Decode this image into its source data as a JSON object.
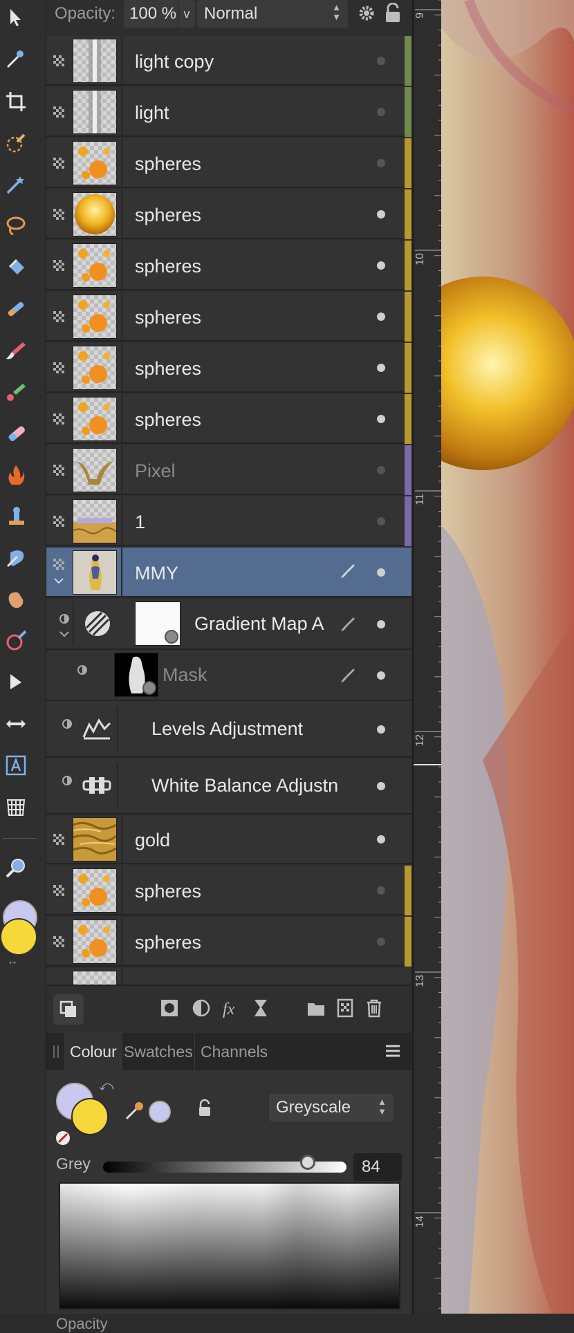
{
  "header": {
    "opacity_label": "Opacity:",
    "opacity_value": "100 %",
    "blend_mode": "Normal"
  },
  "layers": [
    {
      "name": "light copy",
      "visible": false,
      "tag": "#6f8a4b",
      "thumb": "light-streak"
    },
    {
      "name": "light",
      "visible": false,
      "tag": "#6f8a4b",
      "thumb": "light-streak"
    },
    {
      "name": "spheres",
      "visible": false,
      "tag": "#b79a2b",
      "thumb": "small-spheres"
    },
    {
      "name": "spheres",
      "visible": true,
      "tag": "#b79a2b",
      "thumb": "big-sphere"
    },
    {
      "name": "spheres",
      "visible": true,
      "tag": "#b79a2b",
      "thumb": "small-spheres"
    },
    {
      "name": "spheres",
      "visible": true,
      "tag": "#b79a2b",
      "thumb": "small-spheres"
    },
    {
      "name": "spheres",
      "visible": true,
      "tag": "#b79a2b",
      "thumb": "small-spheres"
    },
    {
      "name": "spheres",
      "visible": true,
      "tag": "#b79a2b",
      "thumb": "small-spheres"
    },
    {
      "name": "Pixel",
      "visible": false,
      "tag": "#7a6aa8",
      "thumb": "pixel-shape"
    },
    {
      "name": "1",
      "visible": false,
      "tag": "#7a6aa8",
      "thumb": "gold-strip"
    },
    {
      "name": "MMY",
      "visible": true,
      "tag": "",
      "thumb": "figure",
      "selected": true
    }
  ],
  "children": {
    "gradient_map": "Gradient Map A",
    "mask": "Mask",
    "levels": "Levels Adjustment",
    "white_balance": "White Balance Adjustn"
  },
  "layers_bottom": [
    {
      "name": "gold",
      "visible": true,
      "tag": "",
      "thumb": "gold-texture"
    },
    {
      "name": "spheres",
      "visible": false,
      "tag": "#b79a2b",
      "thumb": "small-spheres"
    },
    {
      "name": "spheres",
      "visible": false,
      "tag": "#b79a2b",
      "thumb": "small-spheres"
    }
  ],
  "colour_panel": {
    "tabs": [
      "Colour",
      "Swatches",
      "Channels"
    ],
    "active_tab": "Colour",
    "model": "Greyscale",
    "slider_label": "Grey",
    "slider_value": "84",
    "slider_fraction": 0.84,
    "bottom_label": "Opacity"
  },
  "ruler": {
    "ticks": [
      "9",
      "10",
      "11",
      "12",
      "13",
      "14"
    ]
  },
  "colors": {
    "primary_fill": "#f7d83a",
    "secondary_fill": "#c8c8f0",
    "selection": "#546c8f"
  }
}
